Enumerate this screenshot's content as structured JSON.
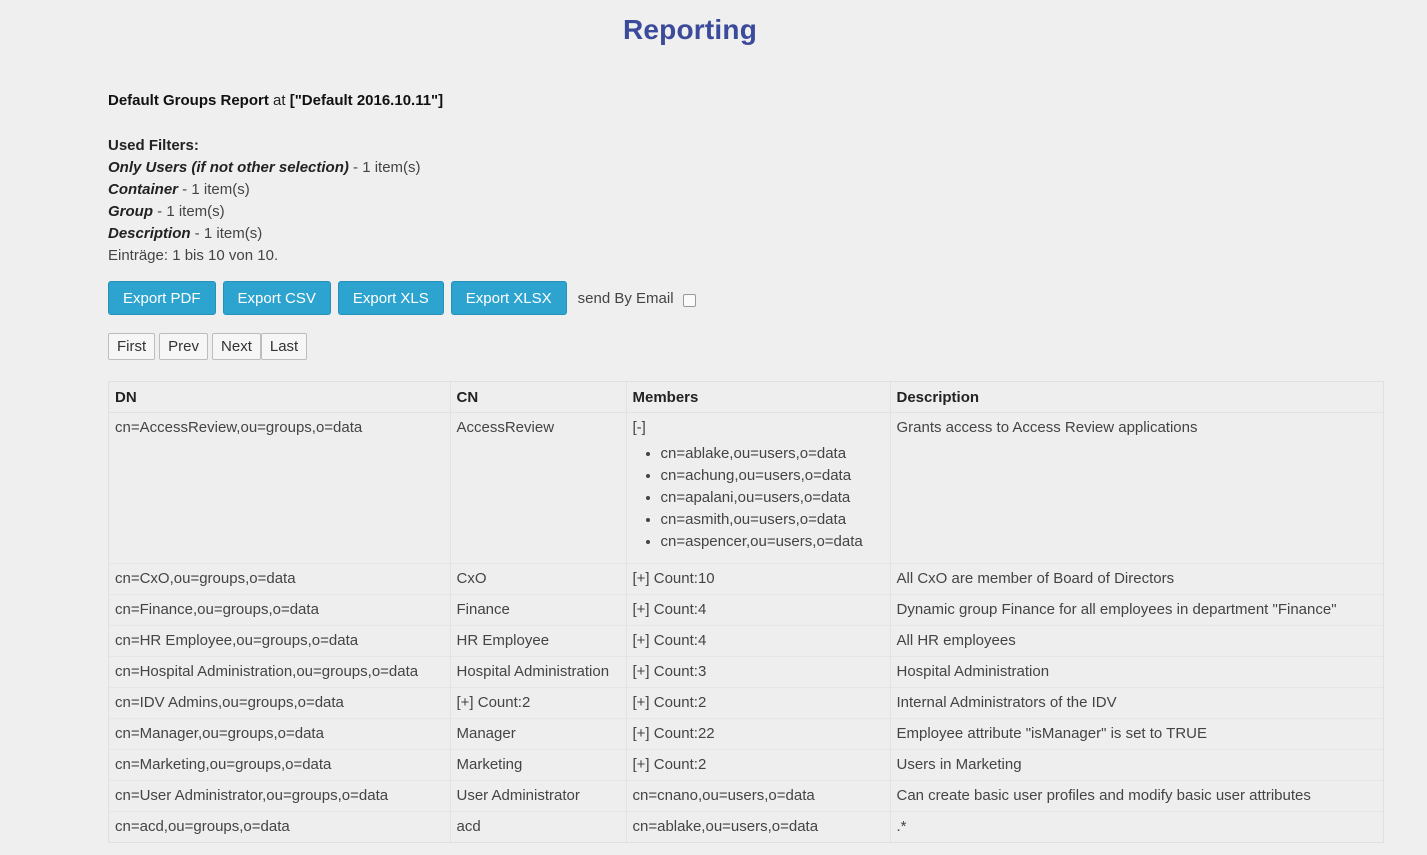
{
  "page_title": "Reporting",
  "report": {
    "name": "Default Groups Report",
    "at_word": "at",
    "target": "[\"Default 2016.10.11\"]"
  },
  "filters": {
    "header": "Used Filters:",
    "items": [
      {
        "name": "Only Users (if not other selection)",
        "suffix": " - 1 item(s)"
      },
      {
        "name": "Container",
        "suffix": " - 1 item(s)"
      },
      {
        "name": "Group",
        "suffix": " - 1 item(s)"
      },
      {
        "name": "Description",
        "suffix": " - 1 item(s)"
      }
    ],
    "entries": "Einträge: 1 bis 10 von 10."
  },
  "exports": {
    "pdf": "Export PDF",
    "csv": "Export CSV",
    "xls": "Export XLS",
    "xlsx": "Export XLSX",
    "send_by_email": "send By Email"
  },
  "pager": {
    "first": "First",
    "prev": "Prev",
    "next": "Next",
    "last": "Last"
  },
  "table": {
    "headers": {
      "dn": "DN",
      "cn": "CN",
      "members": "Members",
      "description": "Description"
    },
    "first_row": {
      "dn": "cn=AccessReview,ou=groups,o=data",
      "cn": "AccessReview",
      "toggle": "[-]",
      "members": [
        "cn=ablake,ou=users,o=data",
        "cn=achung,ou=users,o=data",
        "cn=apalani,ou=users,o=data",
        "cn=asmith,ou=users,o=data",
        "cn=aspencer,ou=users,o=data"
      ],
      "description": "Grants access to Access Review applications"
    },
    "rows": [
      {
        "dn": "cn=CxO,ou=groups,o=data",
        "cn": "CxO",
        "members": "[+] Count:10",
        "description": "All CxO are member of Board of Directors"
      },
      {
        "dn": "cn=Finance,ou=groups,o=data",
        "cn": "Finance",
        "members": "[+] Count:4",
        "description": "Dynamic group Finance for all employees in department \"Finance\""
      },
      {
        "dn": "cn=HR Employee,ou=groups,o=data",
        "cn": "HR Employee",
        "members": "[+] Count:4",
        "description": "All HR employees"
      },
      {
        "dn": "cn=Hospital Administration,ou=groups,o=data",
        "cn": "Hospital Administration",
        "members": "[+] Count:3",
        "description": "Hospital Administration"
      },
      {
        "dn": "cn=IDV Admins,ou=groups,o=data",
        "cn": "[+] Count:2",
        "members": "[+] Count:2",
        "description": "Internal Administrators of the IDV"
      },
      {
        "dn": "cn=Manager,ou=groups,o=data",
        "cn": "Manager",
        "members": "[+] Count:22",
        "description": "Employee attribute \"isManager\" is set to TRUE"
      },
      {
        "dn": "cn=Marketing,ou=groups,o=data",
        "cn": "Marketing",
        "members": "[+] Count:2",
        "description": "Users in Marketing"
      },
      {
        "dn": "cn=User Administrator,ou=groups,o=data",
        "cn": "User Administrator",
        "members": "cn=cnano,ou=users,o=data",
        "description": "Can create basic user profiles and modify basic user attributes"
      },
      {
        "dn": "cn=acd,ou=groups,o=data",
        "cn": "acd",
        "members": "cn=ablake,ou=users,o=data",
        "description": ".*"
      }
    ]
  },
  "colors": {
    "title": "#3b4a9a",
    "export_button": "#2da4cf",
    "background": "#efefef"
  }
}
